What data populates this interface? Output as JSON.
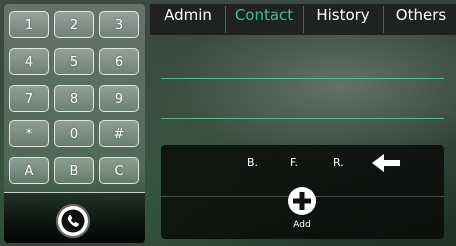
{
  "keypad": {
    "keys": [
      "1",
      "2",
      "3",
      "4",
      "5",
      "6",
      "7",
      "8",
      "9",
      "*",
      "0",
      "#",
      "A",
      "B",
      "C"
    ]
  },
  "call": {
    "icon": "phone-icon"
  },
  "tabs": [
    {
      "label": "Admin",
      "active": false
    },
    {
      "label": "Contact",
      "active": true
    },
    {
      "label": "History",
      "active": false
    },
    {
      "label": "Others",
      "active": false
    }
  ],
  "panel": {
    "items": [
      "B.",
      "F.",
      "R."
    ],
    "back_icon": "left-arrow-icon",
    "add_label": "Add",
    "add_icon": "plus-icon"
  },
  "colors": {
    "accent": "#3fc08a",
    "panel": "#0a0c0b",
    "tabbar": "#1c201e"
  }
}
